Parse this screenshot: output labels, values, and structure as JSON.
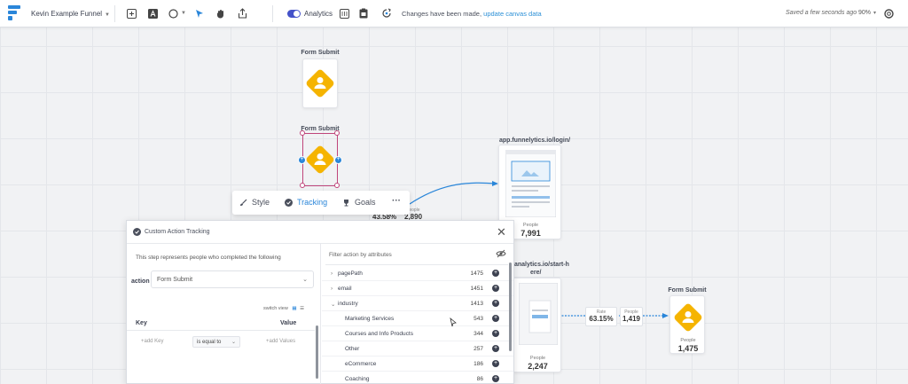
{
  "topbar": {
    "funnel_name": "Kevin Example Funnel",
    "analytics_label": "Analytics",
    "changes_text": "Changes have been made,",
    "update_link": "update canvas data",
    "saved_text": "Saved a few seconds ago",
    "zoom": "90%"
  },
  "canvas": {
    "node_top": {
      "title": "Form Submit"
    },
    "node_selected": {
      "title": "Form Submit"
    },
    "login_page": {
      "title": "app.funnelytics.io/login/",
      "people_label": "People",
      "people_value": "7,991"
    },
    "start_page": {
      "title": "analytics.io/start-h",
      "title2": "ere/",
      "people_label": "People",
      "people_value": "2,247"
    },
    "form_submit_right": {
      "title": "Form Submit",
      "people_label": "People",
      "people_value": "1,475"
    },
    "stats_left": {
      "rate": "43.58%",
      "people_label": "People",
      "people_value": "2,890"
    },
    "stats_right": {
      "rate_label": "Rate",
      "rate": "63.15%",
      "people_label": "People",
      "people_value": "1,419"
    }
  },
  "step_tools": {
    "style": "Style",
    "tracking": "Tracking",
    "goals": "Goals",
    "more": "···"
  },
  "panel": {
    "title": "Custom Action Tracking",
    "description": "This step represents people who completed the following",
    "action_label": "action",
    "action_value": "Form Submit",
    "switch_view": "switch view",
    "key_header": "Key",
    "value_header": "Value",
    "add_key": "+add Key",
    "operator": "is equal to",
    "add_values": "+add Values",
    "filter_placeholder": "Filter action by attributes",
    "attributes": [
      {
        "name": "pagePath",
        "count": "1475",
        "caret": "›"
      },
      {
        "name": "email",
        "count": "1451",
        "caret": "›"
      },
      {
        "name": "industry",
        "count": "1413",
        "caret": "⌄"
      }
    ],
    "sub_attributes": [
      {
        "name": "Marketing Services",
        "count": "543"
      },
      {
        "name": "Courses and Info Products",
        "count": "344"
      },
      {
        "name": "Other",
        "count": "257"
      },
      {
        "name": "eCommerce",
        "count": "186"
      },
      {
        "name": "Coaching",
        "count": "86"
      }
    ]
  },
  "colors": {
    "accent": "#2a86d9",
    "selection": "#c0457b",
    "form_icon": "#f5b400",
    "toggle": "#4452c9"
  }
}
